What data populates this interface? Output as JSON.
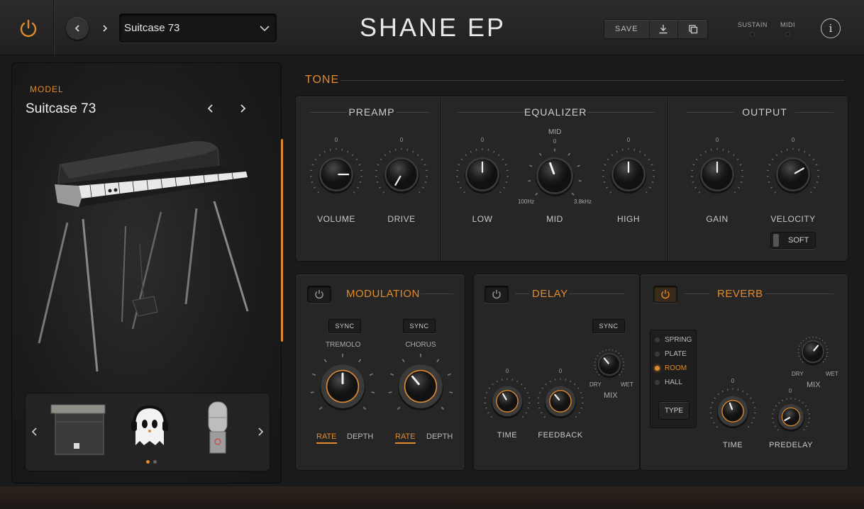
{
  "header": {
    "preset": "Suitcase 73",
    "title": "SHANE EP",
    "save_label": "SAVE",
    "sustain_label": "SUSTAIN",
    "midi_label": "MIDI",
    "info_glyph": "i"
  },
  "model": {
    "label": "MODEL",
    "name": "Suitcase 73"
  },
  "tone": {
    "header": "TONE",
    "preamp": {
      "title": "PREAMP",
      "volume": "VOLUME",
      "drive": "DRIVE",
      "zero": "0"
    },
    "equalizer": {
      "title": "EQUALIZER",
      "low": "LOW",
      "mid": "MID",
      "high": "HIGH",
      "mid_top": "MID",
      "freq_low": "100Hz",
      "freq_high": "3.8kHz",
      "zero": "0"
    },
    "output": {
      "title": "OUTPUT",
      "gain": "GAIN",
      "velocity": "VELOCITY",
      "soft": "SOFT",
      "zero": "0"
    }
  },
  "modulation": {
    "title": "MODULATION",
    "sync": "SYNC",
    "tremolo": "TREMOLO",
    "chorus": "CHORUS",
    "rate": "RATE",
    "depth": "DEPTH"
  },
  "delay": {
    "title": "DELAY",
    "sync": "SYNC",
    "dry": "DRY",
    "wet": "WET",
    "mix": "MIX",
    "time": "TIME",
    "feedback": "FEEDBACK",
    "zero": "0"
  },
  "reverb": {
    "title": "REVERB",
    "types": [
      "SPRING",
      "PLATE",
      "ROOM",
      "HALL"
    ],
    "type_btn": "TYPE",
    "dry": "DRY",
    "wet": "WET",
    "mix": "MIX",
    "time": "TIME",
    "predelay": "PREDELAY",
    "zero": "0"
  },
  "colors": {
    "accent": "#e08a2e",
    "panel": "#262626",
    "background": "#1a1a1a"
  },
  "icons": [
    "power-icon",
    "chevron-left-icon",
    "chevron-right-icon",
    "chevron-down-icon",
    "download-icon",
    "copy-icon",
    "info-icon"
  ]
}
